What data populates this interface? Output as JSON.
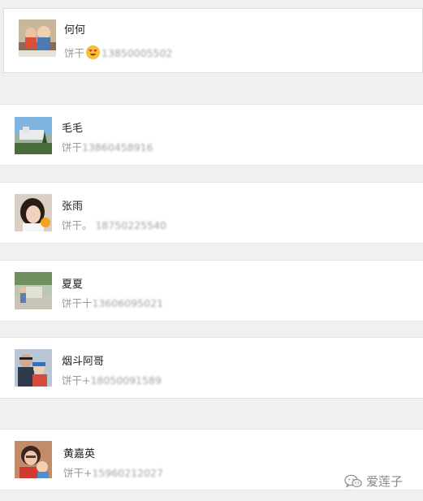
{
  "contacts": [
    {
      "name": "何何",
      "sub_prefix": "饼干",
      "has_emoji": true,
      "emoji_icon": "heart-eyes-emoji",
      "phone": "13850005502"
    },
    {
      "name": "毛毛",
      "sub_prefix": "饼干",
      "phone": "13860458916"
    },
    {
      "name": "张雨",
      "sub_prefix": "饼干。 ",
      "phone": "18750225540"
    },
    {
      "name": "夏夏",
      "sub_prefix": "饼干十",
      "phone": "13606095021"
    },
    {
      "name": "烟斗阿哥",
      "sub_prefix": "饼干+",
      "phone": "18050091589"
    },
    {
      "name": "黄嘉英",
      "sub_prefix": "饼干+",
      "phone": "15960212027"
    }
  ],
  "watermark": {
    "icon": "wechat-icon",
    "text": "爱莲子"
  }
}
